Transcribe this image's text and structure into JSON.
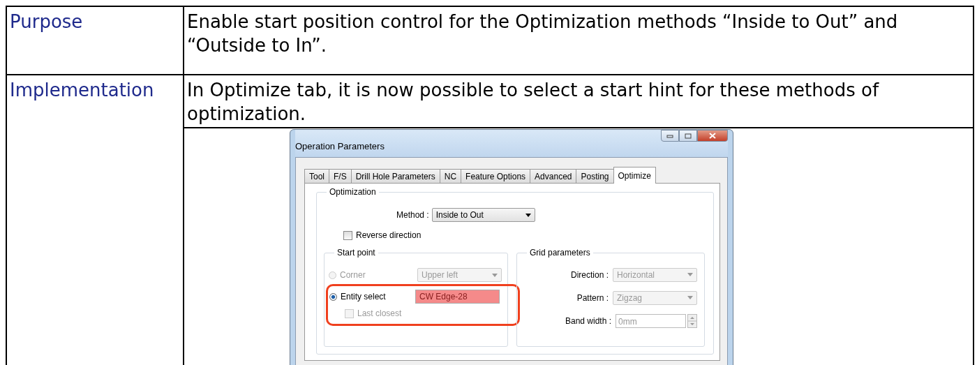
{
  "rows": [
    {
      "label": "Purpose",
      "text": "Enable start position control for the Optimization methods “Inside to Out” and “Outside to In”."
    },
    {
      "label": "Implementation",
      "text": "In Optimize tab, it is now possible to select a start hint for these methods of optimization."
    }
  ],
  "dialog": {
    "title": "Operation Parameters",
    "tabs": [
      {
        "label": "Tool",
        "selected": false
      },
      {
        "label": "F/S",
        "selected": false
      },
      {
        "label": "Drill Hole Parameters",
        "selected": false
      },
      {
        "label": "NC",
        "selected": false
      },
      {
        "label": "Feature Options",
        "selected": false
      },
      {
        "label": "Advanced",
        "selected": false
      },
      {
        "label": "Posting",
        "selected": false
      },
      {
        "label": "Optimize",
        "selected": true
      }
    ],
    "optimization": {
      "legend": "Optimization",
      "method_label": "Method :",
      "method_value": "Inside to Out",
      "reverse": {
        "label": "Reverse direction",
        "checked": false
      }
    },
    "start_point": {
      "legend": "Start point",
      "options": [
        {
          "label": "Corner",
          "selected": false,
          "disabled": true,
          "kind": "dropdown",
          "value": "Upper left"
        },
        {
          "label": "Entity select",
          "selected": true,
          "disabled": false,
          "kind": "entity",
          "value": "CW Edge-28"
        }
      ],
      "last_closest": {
        "label": "Last closest",
        "checked": false,
        "disabled": true
      }
    },
    "grid": {
      "legend": "Grid parameters",
      "fields": [
        {
          "label": "Direction :",
          "value": "Horizontal",
          "kind": "dropdown"
        },
        {
          "label": "Pattern :",
          "value": "Zigzag",
          "kind": "dropdown"
        },
        {
          "label": "Band width :",
          "value": "0mm",
          "kind": "spin"
        }
      ]
    }
  }
}
